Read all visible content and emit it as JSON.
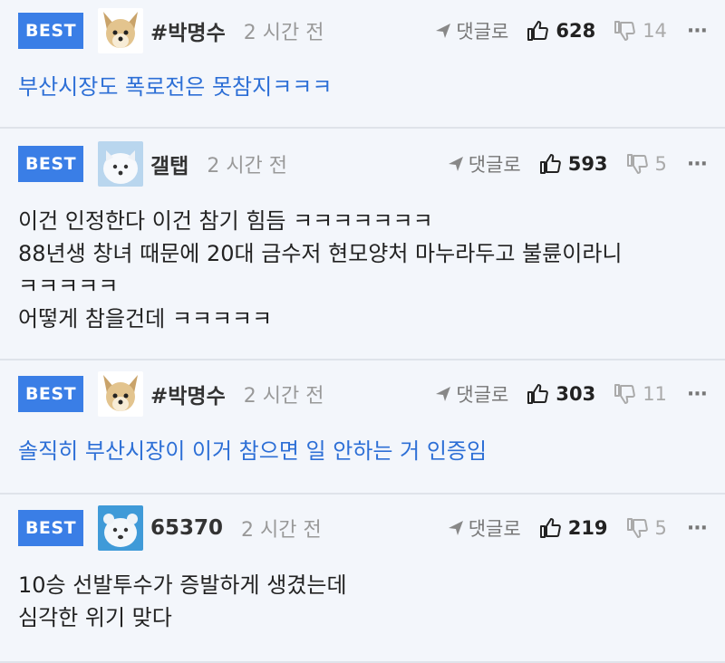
{
  "comments": [
    {
      "badge": "BEST",
      "avatar": "chihuahua-avatar",
      "nickname": "#박명수",
      "time": "2 시간 전",
      "reply_label": "댓글로",
      "likes": "628",
      "dislikes": "14",
      "more": "···",
      "lines": [
        "부산시장도 폭로전은 못참지ㅋㅋㅋ"
      ]
    },
    {
      "badge": "BEST",
      "avatar": "white-dog-avatar",
      "nickname": "갤탭",
      "time": "2 시간 전",
      "reply_label": "댓글로",
      "likes": "593",
      "dislikes": "5",
      "more": "···",
      "lines": [
        "이건 인정한다 이건 참기 힘듬 ㅋㅋㅋㅋㅋㅋㅋ",
        "88년생 창녀 때문에 20대 금수저 현모양처 마누라두고 불륜이라니",
        "ㅋㅋㅋㅋㅋ",
        "어떻게 참을건데 ㅋㅋㅋㅋㅋ"
      ]
    },
    {
      "badge": "BEST",
      "avatar": "chihuahua-avatar",
      "nickname": "#박명수",
      "time": "2 시간 전",
      "reply_label": "댓글로",
      "likes": "303",
      "dislikes": "11",
      "more": "···",
      "lines": [
        "솔직히 부산시장이 이거 참으면 일 안하는 거 인증임"
      ]
    },
    {
      "badge": "BEST",
      "avatar": "polar-bear-avatar",
      "nickname": "65370",
      "time": "2 시간 전",
      "reply_label": "댓글로",
      "likes": "219",
      "dislikes": "5",
      "more": "···",
      "lines": [
        "10승 선발투수가 증발하게 생겼는데",
        "심각한 위기 맞다"
      ]
    }
  ],
  "colors": {
    "badge": "#3a7ee6",
    "link_text": "#2d6fd6",
    "background": "#f3f6fb"
  }
}
